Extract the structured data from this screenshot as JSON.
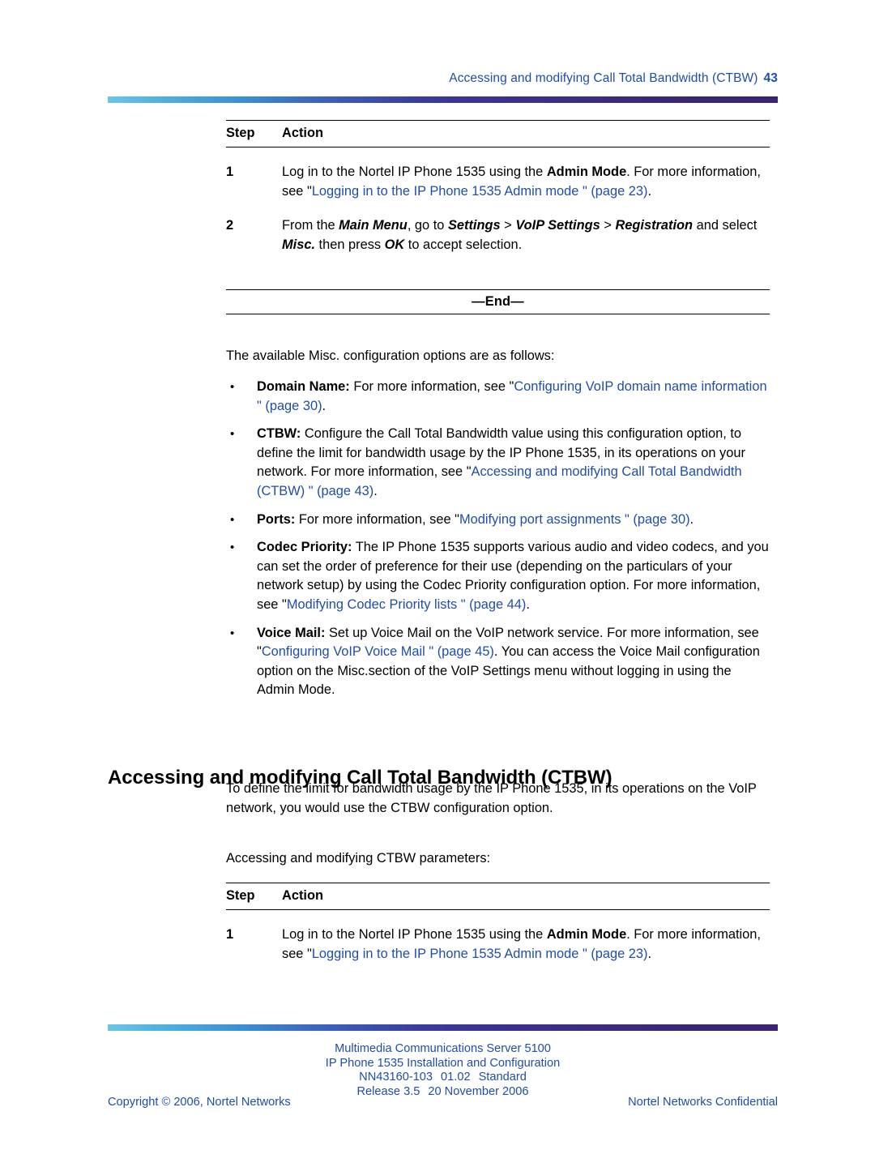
{
  "header": {
    "title": "Accessing and modifying Call Total Bandwidth (CTBW)",
    "page_number": "43"
  },
  "colors": {
    "link_blue": "#1f4ea8",
    "gradient_left": "#6cc4e8",
    "gradient_mid": "#3a3a9e",
    "gradient_right": "#3b2475",
    "text_black": "#000000"
  },
  "table1": {
    "col_step": "Step",
    "col_action": "Action",
    "end_label": "—End—",
    "rows": [
      {
        "step": "1",
        "action_parts": [
          {
            "text": "Log in to the Nortel IP Phone 1535 using the ",
            "style": "plain"
          },
          {
            "text": "Admin Mode",
            "style": "bold"
          },
          {
            "text": ". For more information, see \"",
            "style": "plain"
          },
          {
            "text": "Logging in to the IP Phone 1535 Admin mode \" (page 23)",
            "style": "link"
          },
          {
            "text": ".",
            "style": "plain"
          }
        ]
      },
      {
        "step": "2",
        "action_parts": [
          {
            "text": "From the ",
            "style": "plain"
          },
          {
            "text": "Main Menu",
            "style": "bolditalic"
          },
          {
            "text": ", go to ",
            "style": "plain"
          },
          {
            "text": "Settings",
            "style": "bolditalic"
          },
          {
            "text": " > ",
            "style": "plain"
          },
          {
            "text": "VoIP Settings",
            "style": "bolditalic"
          },
          {
            "text": " > ",
            "style": "plain"
          },
          {
            "text": "Registration",
            "style": "bolditalic"
          },
          {
            "text": " and select ",
            "style": "plain"
          },
          {
            "text": "Misc.",
            "style": "bolditalic"
          },
          {
            "text": " then press ",
            "style": "plain"
          },
          {
            "text": "OK",
            "style": "bolditalic"
          },
          {
            "text": " to accept selection.",
            "style": "plain"
          }
        ]
      }
    ]
  },
  "intro_paragraph": "The available Misc. configuration options are as follows:",
  "bullet_marker": "•",
  "bullets": [
    {
      "name": "domain-name",
      "parts": [
        {
          "text": "Domain Name:",
          "style": "bold"
        },
        {
          "text": " For more information, see \"",
          "style": "plain"
        },
        {
          "text": "Configuring VoIP domain name information \" (page 30)",
          "style": "link"
        },
        {
          "text": ".",
          "style": "plain"
        }
      ]
    },
    {
      "name": "ctbw",
      "parts": [
        {
          "text": "CTBW:",
          "style": "bold"
        },
        {
          "text": " Configure the Call Total Bandwidth value using this configuration option, to define the limit for bandwidth usage by the IP Phone 1535, in its operations on your network. For more information, see \"",
          "style": "plain"
        },
        {
          "text": "Accessing and modifying Call Total Bandwidth (CTBW) \" (page 43)",
          "style": "link"
        },
        {
          "text": ".",
          "style": "plain"
        }
      ]
    },
    {
      "name": "ports",
      "parts": [
        {
          "text": "Ports:",
          "style": "bold"
        },
        {
          "text": " For more information, see \"",
          "style": "plain"
        },
        {
          "text": "Modifying port assignments \" (page 30)",
          "style": "link"
        },
        {
          "text": ".",
          "style": "plain"
        }
      ]
    },
    {
      "name": "codec-priority",
      "parts": [
        {
          "text": "Codec Priority:",
          "style": "bold"
        },
        {
          "text": " The IP Phone 1535 supports various audio and video codecs, and you can set the order of preference for their use (depending on the particulars of your network setup) by using the Codec Priority configuration option. For more information, see \"",
          "style": "plain"
        },
        {
          "text": "Modifying Codec Priority lists \" (page 44)",
          "style": "link"
        },
        {
          "text": ".",
          "style": "plain"
        }
      ]
    },
    {
      "name": "voice-mail",
      "parts": [
        {
          "text": "Voice Mail:",
          "style": "bold"
        },
        {
          "text": " Set up Voice Mail on the VoIP network service. For more information, see \"",
          "style": "plain"
        },
        {
          "text": "Configuring VoIP Voice Mail \" (page 45)",
          "style": "link"
        },
        {
          "text": ". You can access the Voice Mail configuration option on the Misc.section of the VoIP Settings menu without logging in using the Admin Mode.",
          "style": "plain"
        }
      ]
    }
  ],
  "section": {
    "heading": "Accessing and modifying Call Total Bandwidth (CTBW)",
    "paragraph": "To define the limit for bandwidth usage by the IP Phone 1535, in its operations on the VoIP network, you would use the CTBW configuration option.",
    "lead_in": "Accessing and modifying CTBW parameters:"
  },
  "table2": {
    "col_step": "Step",
    "col_action": "Action",
    "rows": [
      {
        "step": "1",
        "action_parts": [
          {
            "text": "Log in to the Nortel IP Phone 1535 using the ",
            "style": "plain"
          },
          {
            "text": "Admin Mode",
            "style": "bold"
          },
          {
            "text": ". For more information, see \"",
            "style": "plain"
          },
          {
            "text": "Logging in to the IP Phone 1535 Admin mode \" (page 23)",
            "style": "link"
          },
          {
            "text": ".",
            "style": "plain"
          }
        ]
      }
    ]
  },
  "footer": {
    "line1": "Multimedia Communications Server 5100",
    "line2": "IP Phone 1535 Installation and Configuration",
    "line3_doc": "NN43160-103",
    "line3_version": "01.02",
    "line3_status": "Standard",
    "line4_release": "Release 3.5",
    "line4_date": "20 November 2006",
    "copyright": "Copyright © 2006, Nortel Networks",
    "confidential": "Nortel Networks Confidential"
  }
}
